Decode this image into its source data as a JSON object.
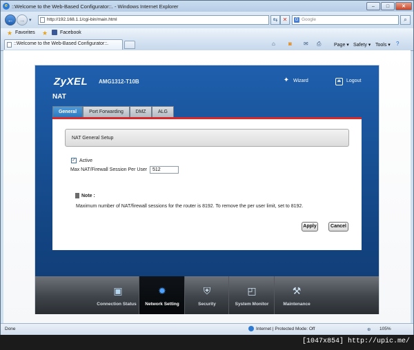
{
  "browser": {
    "window_title": "::Welcome to the Web-Based Configurator::. - Windows Internet Explorer",
    "url": "http://192.168.1.1/cgi-bin/main.html",
    "search_placeholder": "Google",
    "favorites_label": "Favorites",
    "favorite_link": "Facebook",
    "tab_title": "::Welcome to the Web-Based Configurator::.",
    "commands": {
      "page": "Page",
      "safety": "Safety",
      "tools": "Tools"
    },
    "status_left": "Done",
    "status_zone": "Internet | Protected Mode: Off",
    "zoom": "105%"
  },
  "router": {
    "brand": "ZyXEL",
    "model": "AMG1312-T10B",
    "wizard_label": "Wizard",
    "logout_label": "Logout",
    "page_title": "NAT",
    "tabs": [
      {
        "label": "General",
        "active": true
      },
      {
        "label": "Port Forwarding",
        "active": false
      },
      {
        "label": "DMZ",
        "active": false
      },
      {
        "label": "ALG",
        "active": false
      }
    ],
    "section_title": "NAT General Setup",
    "active_label": "Active",
    "active_checked": true,
    "session_label": "Max NAT/Firewall Session Per User",
    "session_value": "512",
    "note_title": "Note :",
    "note_text": "Maximum number of NAT/firewall sessions for the router is 8192. To remove the per user limit, set to 8192.",
    "apply_label": "Apply",
    "cancel_label": "Cancel",
    "nav": [
      {
        "label": "Connection Status",
        "icon": "monitor-icon"
      },
      {
        "label": "Network Setting",
        "icon": "globe-icon",
        "active": true
      },
      {
        "label": "Security",
        "icon": "shield-icon"
      },
      {
        "label": "System Monitor",
        "icon": "chart-icon"
      },
      {
        "label": "Maintenance",
        "icon": "tools-icon"
      }
    ]
  },
  "watermark": "[1047x854] http://upic.me/",
  "colors": {
    "router_blue": "#1b57a0",
    "accent_red": "#d8282c",
    "tab_blue": "#2c79bf"
  }
}
